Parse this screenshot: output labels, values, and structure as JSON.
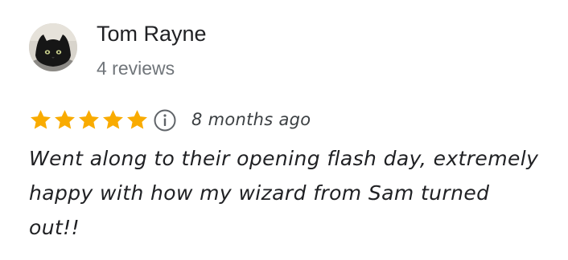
{
  "review": {
    "author": {
      "name": "Tom Rayne",
      "reviews_count": "4 reviews",
      "avatar": "cat-photo-avatar"
    },
    "rating": {
      "stars": 5,
      "max_stars": 5,
      "star_color": "#f9ab00"
    },
    "info_icon": "info-icon",
    "time_ago": "8 months ago",
    "text": "Went along to their opening flash day, extremely happy with how my wizard from Sam turned out!!"
  }
}
